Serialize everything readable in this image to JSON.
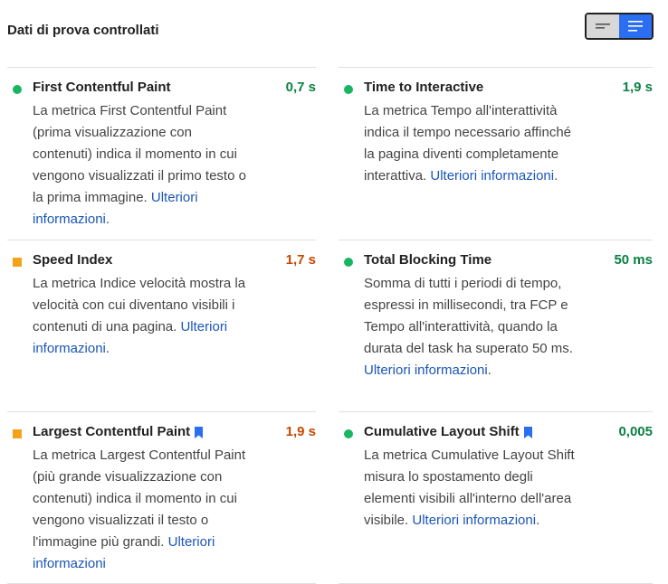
{
  "header": {
    "title": "Dati di prova controllati"
  },
  "view_toggle": {
    "compact_icon": "compact-list-icon",
    "expanded_icon": "expanded-list-icon",
    "selected": "expanded"
  },
  "colors": {
    "pass": "#0c8043",
    "average": "#c24a00",
    "pass_indicator": "#18b663",
    "average_indicator": "#f4a21a",
    "link": "#1a56b8"
  },
  "metrics": {
    "fcp": {
      "title": "First Contentful Paint",
      "value": "0,7 s",
      "status": "pass",
      "description": "La metrica First Contentful Paint (prima visualizzazione con contenuti) indica il momento in cui vengono visualizzati il primo testo o la prima immagine.",
      "link": "Ulteriori informazioni",
      "trailing": "."
    },
    "tti": {
      "title": "Time to Interactive",
      "value": "1,9 s",
      "status": "pass",
      "description": "La metrica Tempo all'interattività indica il tempo necessario affinché la pagina diventi completamente interattiva.",
      "link": "Ulteriori informazioni",
      "trailing": "."
    },
    "si": {
      "title": "Speed Index",
      "value": "1,7 s",
      "status": "average",
      "description": "La metrica Indice velocità mostra la velocità con cui diventano visibili i contenuti di una pagina.",
      "link": "Ulteriori informazioni",
      "trailing": "."
    },
    "tbt": {
      "title": "Total Blocking Time",
      "value": "50 ms",
      "status": "pass",
      "description": "Somma di tutti i periodi di tempo, espressi in millisecondi, tra FCP e Tempo all'interattività, quando la durata del task ha superato 50 ms.",
      "link": "Ulteriori informazioni",
      "trailing": "."
    },
    "lcp": {
      "title": "Largest Contentful Paint",
      "value": "1,9 s",
      "status": "average",
      "description": "La metrica Largest Contentful Paint (più grande visualizzazione con contenuti) indica il momento in cui vengono visualizzati il testo o l'immagine più grandi.",
      "link": "Ulteriori informazioni",
      "trailing": "",
      "icon": "bookmark-icon"
    },
    "cls": {
      "title": "Cumulative Layout Shift",
      "value": "0,005",
      "status": "pass",
      "description": "La metrica Cumulative Layout Shift misura lo spostamento degli elementi visibili all'interno dell'area visibile.",
      "link": "Ulteriori informazioni",
      "trailing": ".",
      "icon": "bookmark-icon"
    }
  }
}
